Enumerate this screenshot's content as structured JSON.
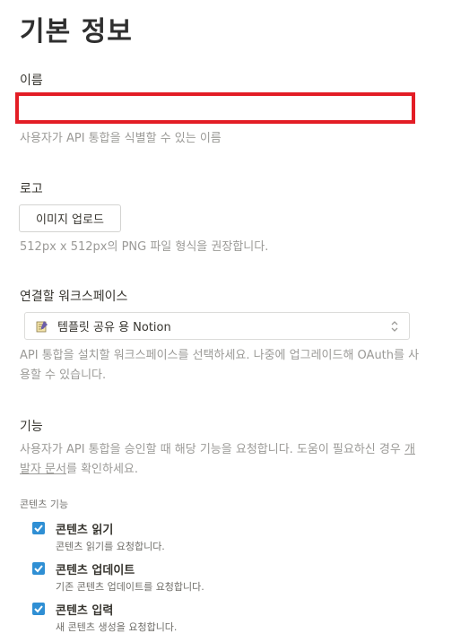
{
  "page_title": "기본 정보",
  "name_field": {
    "label": "이름",
    "value": "",
    "hint": "사용자가 API 통합을 식별할 수 있는 이름"
  },
  "logo": {
    "label": "로고",
    "button": "이미지 업로드",
    "hint": "512px x 512px의 PNG 파일 형식을 권장합니다."
  },
  "workspace": {
    "label": "연결할 워크스페이스",
    "icon": "notion-template-icon",
    "selected": "템플릿 공유 용 Notion",
    "hint": "API 통합을 설치할 워크스페이스를 선택하세요. 나중에 업그레이드해 OAuth를 사용할 수 있습니다."
  },
  "features": {
    "label": "기능",
    "hint_before": "사용자가 API 통합을 승인할 때 해당 기능을 요청합니다. 도움이 필요하신 경우 ",
    "hint_link": "개발자 문서",
    "hint_after": "를 확인하세요.",
    "content_heading": "콘텐츠 기능",
    "items": [
      {
        "label": "콘텐츠 읽기",
        "desc": "콘텐츠 읽기를 요청합니다.",
        "checked": true
      },
      {
        "label": "콘텐츠 업데이트",
        "desc": "기존 콘텐츠 업데이트를 요청합니다.",
        "checked": true
      },
      {
        "label": "콘텐츠 입력",
        "desc": "새 콘텐츠 생성을 요청합니다.",
        "checked": true
      }
    ]
  },
  "colors": {
    "highlight": "#e31d25",
    "checkbox": "#2f8fd4"
  }
}
